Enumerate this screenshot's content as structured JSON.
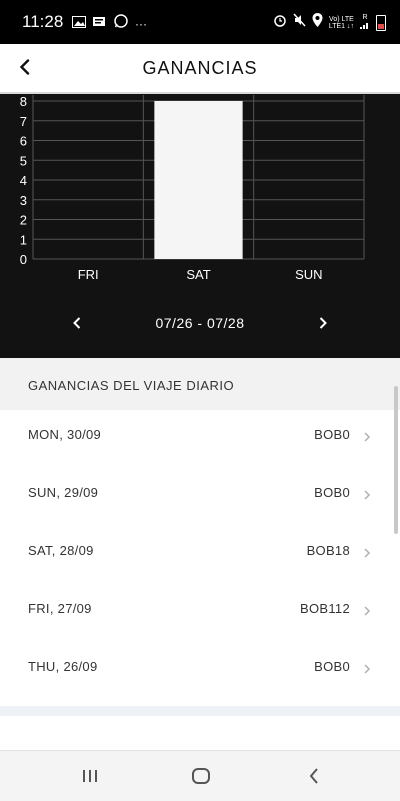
{
  "status_bar": {
    "time": "11:28",
    "more": "···",
    "network_top": "Vo) LTE",
    "network_bottom": "LTE1 ↓↑",
    "sim_label": "R"
  },
  "header": {
    "title": "GANANCIAS"
  },
  "chart_data": {
    "type": "bar",
    "categories": [
      "FRI",
      "SAT",
      "SUN"
    ],
    "values": [
      0,
      8,
      0
    ],
    "ylim": [
      0,
      8
    ],
    "yticks": [
      "0",
      "1",
      "2",
      "3",
      "4",
      "5",
      "6",
      "7",
      "8"
    ],
    "grid": true,
    "bar_color": "#f5f5f5",
    "background": "#121212",
    "title": "",
    "xlabel": "",
    "ylabel": ""
  },
  "week_nav": {
    "range": "07/26 - 07/28"
  },
  "daily": {
    "title": "GANANCIAS DEL VIAJE DIARIO",
    "items": [
      {
        "date": "MON, 30/09",
        "amount": "BOB0"
      },
      {
        "date": "SUN, 29/09",
        "amount": "BOB0"
      },
      {
        "date": "SAT, 28/09",
        "amount": "BOB18"
      },
      {
        "date": "FRI, 27/09",
        "amount": "BOB112"
      },
      {
        "date": "THU, 26/09",
        "amount": "BOB0"
      }
    ]
  },
  "colors": {
    "chart_background": "#121212",
    "list_header_background": "#f2f2f2",
    "text": "#333333"
  }
}
